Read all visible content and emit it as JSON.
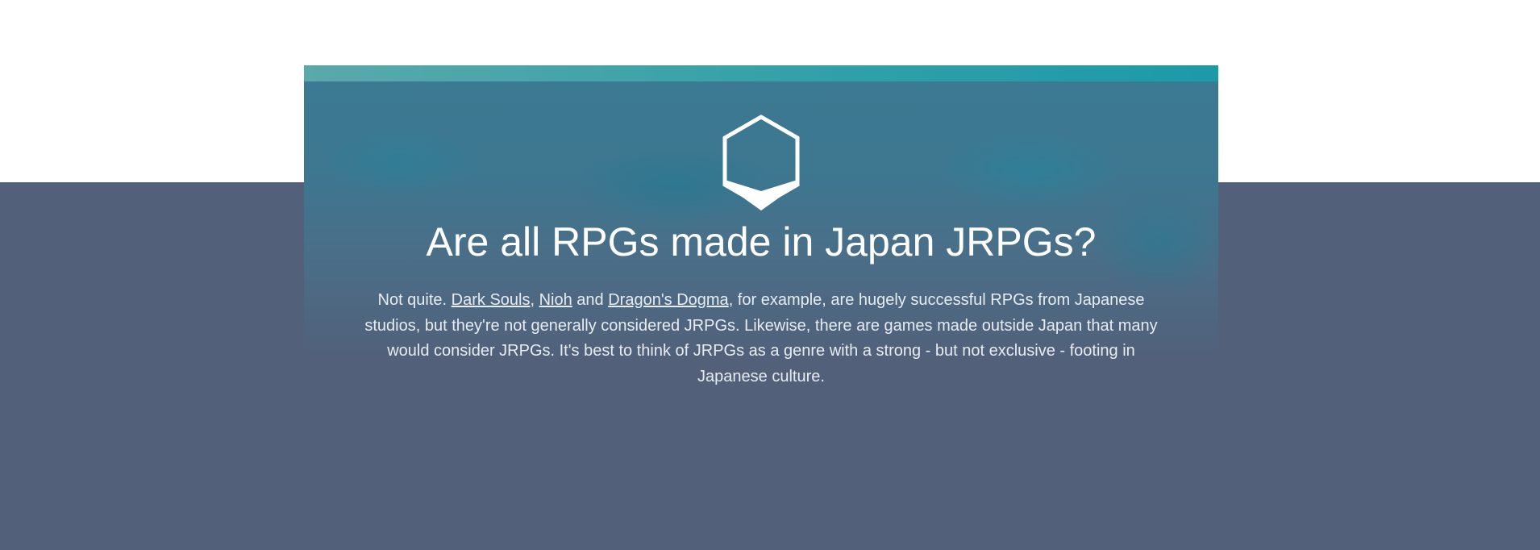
{
  "section": {
    "icon": "hexagon-icon",
    "title": "Are all RPGs made in Japan JRPGs?",
    "answer": {
      "intro": "Not quite. ",
      "links": [
        "Dark Souls",
        "Nioh",
        "Dragon's Dogma"
      ],
      "sep_comma": ", ",
      "sep_and": " and ",
      "rest": ", for example, are hugely successful RPGs from Japanese studios, but they're not generally considered JRPGs. Likewise, there are games made outside Japan that many would consider JRPGs. It's best to think of JRPGs as a genre with a strong - but not exclusive - footing in Japanese culture."
    }
  },
  "colors": {
    "page_top": "#ffffff",
    "page_bottom": "#52607a",
    "card_accent": "#1c9aa8",
    "text": "#ffffff"
  }
}
